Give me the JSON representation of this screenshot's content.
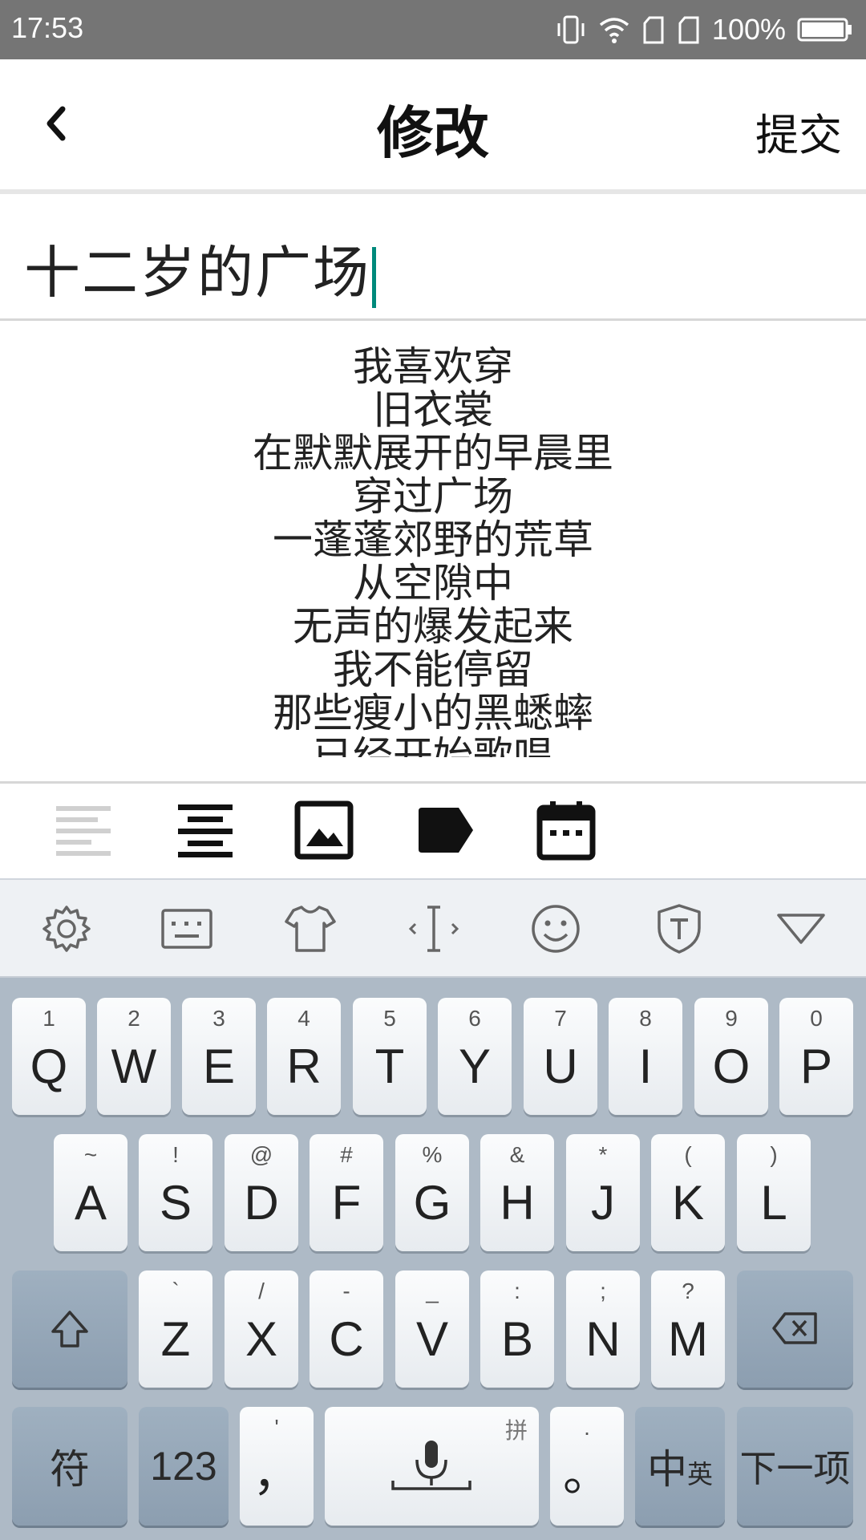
{
  "status_bar": {
    "time": "17:53",
    "battery": "100%"
  },
  "app_bar": {
    "title": "修改",
    "submit": "提交"
  },
  "title_field": {
    "value": "十二岁的广场"
  },
  "content": {
    "lines": [
      "我喜欢穿",
      "旧衣裳",
      "在默默展开的早晨里",
      "穿过广场",
      "一蓬蓬郊野的荒草",
      "从空隙中",
      "无声的爆发起来",
      "我不能停留",
      "那些瘦小的黑蟋蟀",
      "已经开始歌唱"
    ]
  },
  "keyboard": {
    "row1": [
      {
        "main": "Q",
        "sub": "1"
      },
      {
        "main": "W",
        "sub": "2"
      },
      {
        "main": "E",
        "sub": "3"
      },
      {
        "main": "R",
        "sub": "4"
      },
      {
        "main": "T",
        "sub": "5"
      },
      {
        "main": "Y",
        "sub": "6"
      },
      {
        "main": "U",
        "sub": "7"
      },
      {
        "main": "I",
        "sub": "8"
      },
      {
        "main": "O",
        "sub": "9"
      },
      {
        "main": "P",
        "sub": "0"
      }
    ],
    "row2": [
      {
        "main": "A",
        "sub": "~"
      },
      {
        "main": "S",
        "sub": "!"
      },
      {
        "main": "D",
        "sub": "@"
      },
      {
        "main": "F",
        "sub": "#"
      },
      {
        "main": "G",
        "sub": "%"
      },
      {
        "main": "H",
        "sub": "&"
      },
      {
        "main": "J",
        "sub": "*"
      },
      {
        "main": "K",
        "sub": "("
      },
      {
        "main": "L",
        "sub": ")"
      }
    ],
    "row3": [
      {
        "main": "Z",
        "sub": "`"
      },
      {
        "main": "X",
        "sub": "/"
      },
      {
        "main": "C",
        "sub": "-"
      },
      {
        "main": "V",
        "sub": "_"
      },
      {
        "main": "B",
        "sub": ":"
      },
      {
        "main": "N",
        "sub": ";"
      },
      {
        "main": "M",
        "sub": "?"
      }
    ],
    "symbols": "符",
    "numbers": "123",
    "comma": "，",
    "comma_sub": "'",
    "space_hint": "拼",
    "period": "。",
    "period_sub": ".",
    "lang_main": "中",
    "lang_sub": "英",
    "next": "下一项"
  }
}
